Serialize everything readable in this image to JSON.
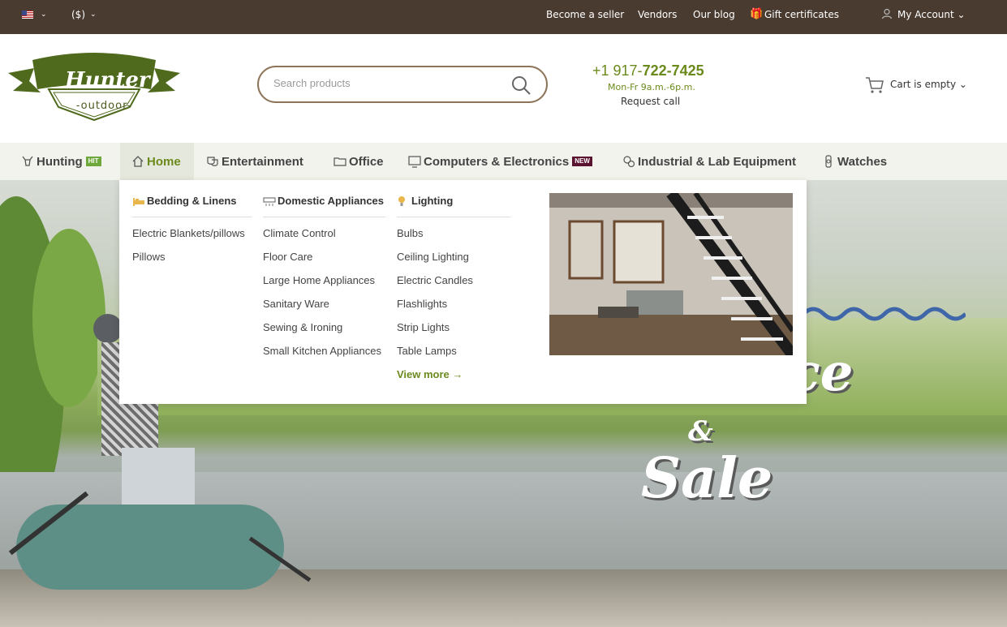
{
  "topbar": {
    "language_icon": "us-flag-icon",
    "currency": "($)",
    "links": [
      "Become a seller",
      "Vendors",
      "Our blog",
      "Gift certificates"
    ],
    "account": "My Account"
  },
  "header": {
    "logo_title": "Hunter",
    "logo_sub": "-outdoor-",
    "search_placeholder": "Search products",
    "phone_prefix": "+1 917-",
    "phone_main": "722-7425",
    "hours": "Mon-Fr 9a.m.-6p.m.",
    "request_call": "Request call",
    "cart": "Cart is empty"
  },
  "nav": {
    "items": [
      {
        "label": "Hunting",
        "badge": "HIT",
        "icon": "deer-icon"
      },
      {
        "label": "Home",
        "icon": "home-icon"
      },
      {
        "label": "Entertainment",
        "icon": "masks-icon"
      },
      {
        "label": "Office",
        "icon": "folder-icon"
      },
      {
        "label": "Computers & Electronics",
        "badge": "NEW",
        "icon": "monitor-icon"
      },
      {
        "label": "Industrial & Lab Equipment",
        "icon": "gears-icon"
      },
      {
        "label": "Watches",
        "icon": "watch-icon"
      }
    ]
  },
  "mega": {
    "columns": [
      {
        "title": "Bedding & Linens",
        "items": [
          "Electric Blankets/pillows",
          "Pillows"
        ]
      },
      {
        "title": "Domestic Appliances",
        "items": [
          "Climate Control",
          "Floor Care",
          "Large Home Appliances",
          "Sanitary Ware",
          "Sewing & Ironing",
          "Small Kitchen Appliances"
        ]
      },
      {
        "title": "Lighting",
        "items": [
          "Bulbs",
          "Ceiling Lighting",
          "Electric Candles",
          "Flashlights",
          "Strip Lights",
          "Table Lamps"
        ],
        "more": "View more →"
      }
    ]
  },
  "hero": {
    "line1": "rance",
    "line2": "&",
    "line3": "Sale"
  },
  "colors": {
    "topbar_bg": "#4a3b31",
    "accent_green": "#6b8a1c",
    "nav_bg": "#f1f3ec",
    "badge_hit": "#6fa83a",
    "badge_new": "#5a1430"
  }
}
